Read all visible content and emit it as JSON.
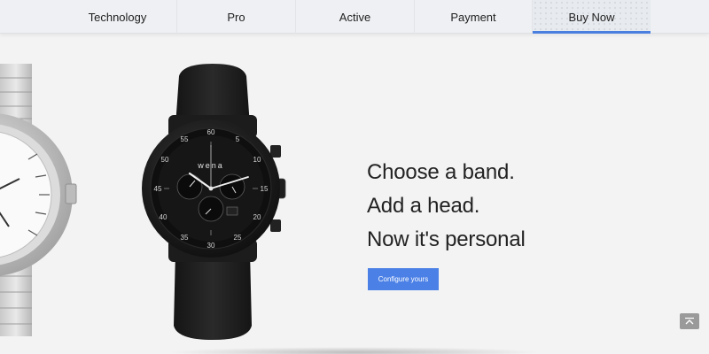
{
  "nav": {
    "tabs": [
      {
        "label": "Technology"
      },
      {
        "label": "Pro"
      },
      {
        "label": "Active"
      },
      {
        "label": "Payment"
      },
      {
        "label": "Buy Now",
        "active": true
      }
    ]
  },
  "hero": {
    "lines": [
      "Choose a band.",
      "Add a head.",
      "Now it's personal"
    ],
    "cta_label": "Configure yours",
    "brand_mark": "wena"
  },
  "colors": {
    "accent": "#4b80e6",
    "background": "#f3f3f3",
    "text": "#222222"
  }
}
